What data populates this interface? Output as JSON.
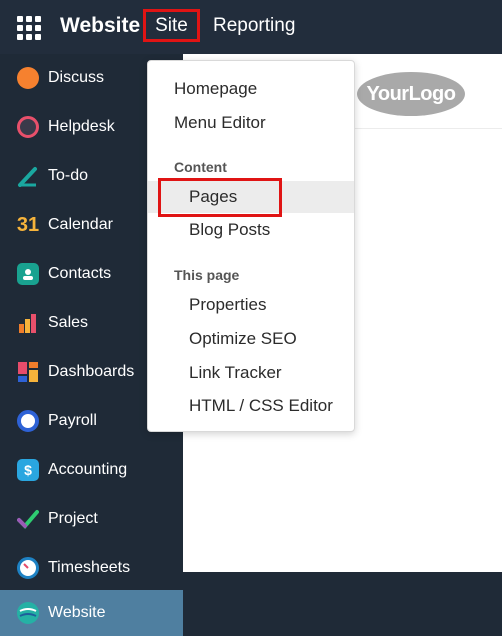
{
  "topbar": {
    "brand": "Website",
    "menus": [
      "Site",
      "Reporting"
    ]
  },
  "sidebar": {
    "items": [
      {
        "label": "Discuss",
        "icon": "discuss-icon",
        "color": "#f6812f"
      },
      {
        "label": "Helpdesk",
        "icon": "helpdesk-icon",
        "color": "#e8506b"
      },
      {
        "label": "To-do",
        "icon": "todo-icon",
        "color": "#1aa8a0"
      },
      {
        "label": "Calendar",
        "icon": "calendar-icon",
        "color": "#f6b33b"
      },
      {
        "label": "Contacts",
        "icon": "contacts-icon",
        "color": "#19a290"
      },
      {
        "label": "Sales",
        "icon": "sales-icon",
        "color": "#ef7d2b"
      },
      {
        "label": "Dashboards",
        "icon": "dashboards-icon",
        "color": "#e74c6b"
      },
      {
        "label": "Payroll",
        "icon": "payroll-icon",
        "color": "#2e62d6"
      },
      {
        "label": "Accounting",
        "icon": "accounting-icon",
        "color": "#2aa6e0"
      },
      {
        "label": "Project",
        "icon": "project-icon",
        "color": "#2ecc71"
      },
      {
        "label": "Timesheets",
        "icon": "timesheets-icon",
        "color": "#1e82c4"
      },
      {
        "label": "Website",
        "icon": "website-icon",
        "color": "#25b1a5"
      }
    ],
    "calendar_glyph": "31"
  },
  "page": {
    "logo_text": "YourLogo"
  },
  "dropdown": {
    "items_top": [
      "Homepage",
      "Menu Editor"
    ],
    "content_header": "Content",
    "content_items": [
      "Pages",
      "Blog Posts"
    ],
    "thispage_header": "This page",
    "thispage_items": [
      "Properties",
      "Optimize SEO",
      "Link Tracker",
      "HTML / CSS Editor"
    ]
  },
  "colors": {
    "topbar_bg": "#222d3c",
    "sidebar_bg": "#1f2a37",
    "active_item_bg": "#4f7fa0",
    "highlight_border": "#e01414"
  }
}
